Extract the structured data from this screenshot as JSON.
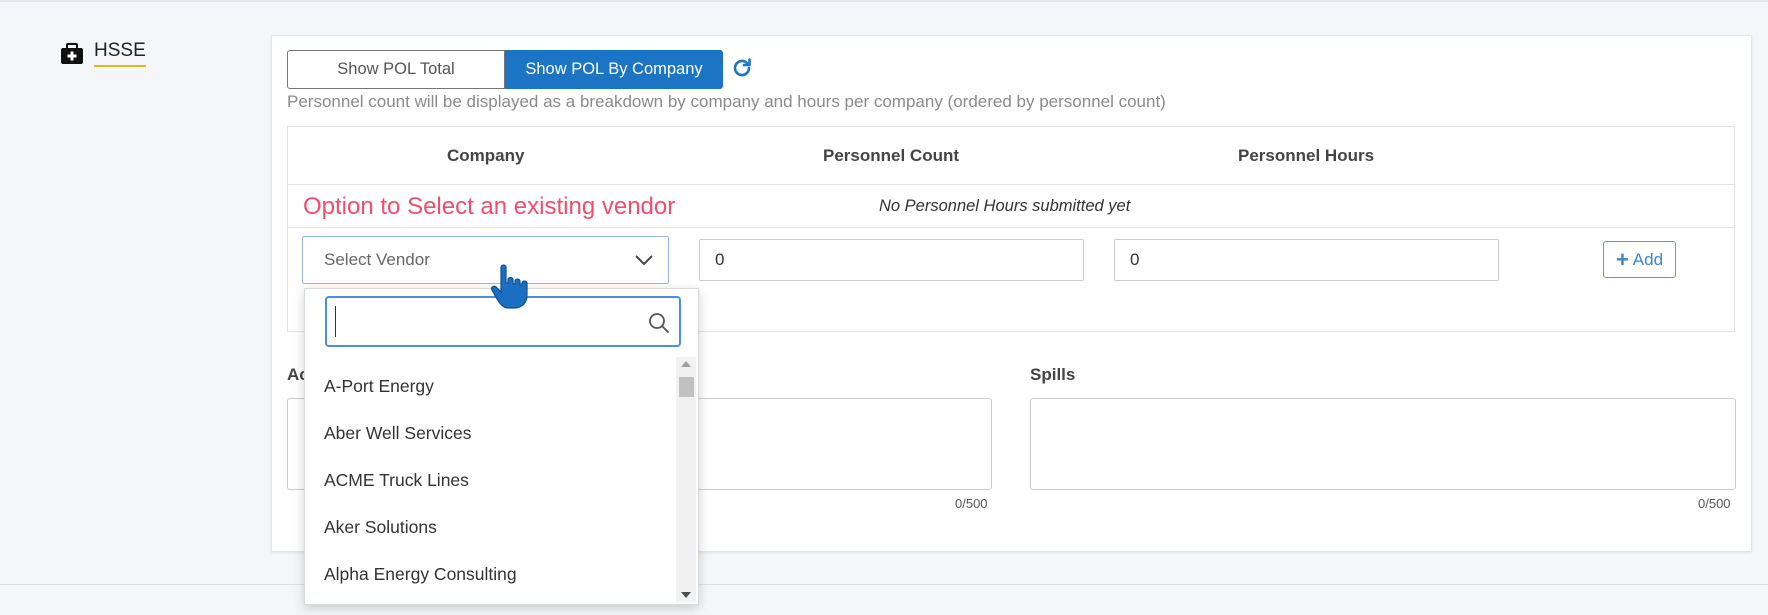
{
  "section": {
    "title": "HSSE",
    "icon": "first-aid-kit-icon"
  },
  "toggle": {
    "option_total": "Show POL Total",
    "option_company": "Show POL By Company",
    "selected": "Show POL By Company"
  },
  "refresh": {
    "icon": "refresh-icon"
  },
  "hint": "Personnel count will be displayed as a breakdown by company and hours per company (ordered by personnel count)",
  "table": {
    "columns": [
      "Company",
      "Personnel Count",
      "Personnel Hours"
    ],
    "annotation": "Option to Select an existing vendor",
    "empty_message": "No Personnel Hours submitted yet",
    "vendor_placeholder": "Select Vendor",
    "count_value": "0",
    "hours_value": "0",
    "add_label": "Add"
  },
  "fields": {
    "left_label": "Ac",
    "left_counter": "0/500",
    "right_label": "Spills",
    "right_counter": "0/500"
  },
  "dropdown": {
    "search_value": "",
    "options": [
      "A-Port Energy",
      "Aber Well Services",
      "ACME Truck Lines",
      "Aker Solutions",
      "Alpha Energy Consulting"
    ]
  },
  "colors": {
    "primary": "#1b74c4",
    "annotation": "#ee4f6e",
    "accent_underline": "#f0b323"
  }
}
